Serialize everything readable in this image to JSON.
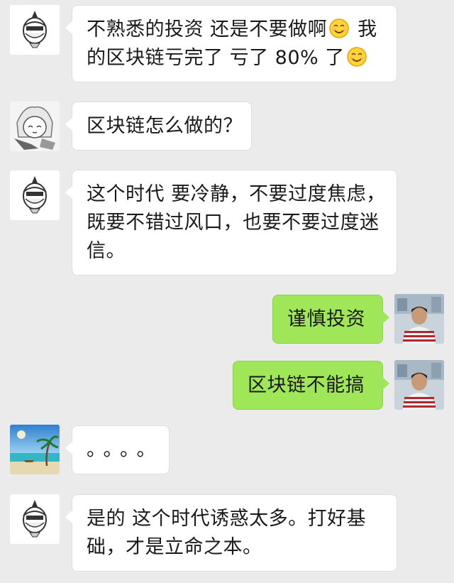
{
  "messages": [
    {
      "side": "left",
      "avatar": "cartoon-helmet-avatar",
      "lines": [
        "不熟悉的投资 还是不要做啊",
        " 我",
        "的区块链亏完了  亏了 80% 了"
      ]
    },
    {
      "side": "left",
      "avatar": "anime-girl-avatar",
      "lines": [
        "区块链怎么做的？"
      ]
    },
    {
      "side": "left",
      "avatar": "cartoon-helmet-avatar",
      "lines": [
        "这个时代 要冷静，不要过度焦虑，",
        "既要不错过风口，也要不要过度迷",
        "信。"
      ]
    },
    {
      "side": "right",
      "avatar": "man-photo-avatar",
      "lines": [
        "谨慎投资"
      ]
    },
    {
      "side": "right",
      "avatar": "man-photo-avatar",
      "lines": [
        "区块链不能搞"
      ]
    },
    {
      "side": "left",
      "avatar": "beach-photo-avatar",
      "lines": [
        "。。。。"
      ]
    },
    {
      "side": "left",
      "avatar": "cartoon-helmet-avatar",
      "lines": [
        "是的 这个时代诱惑太多。打好基",
        "础，才是立命之本。"
      ]
    }
  ],
  "icons": {
    "smile_emoji": "smiling-face-emoji"
  }
}
